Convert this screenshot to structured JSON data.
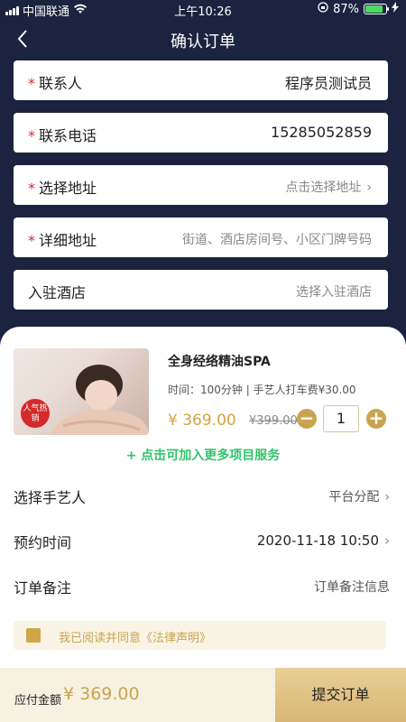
{
  "status_bar": {
    "carrier": "中国联通",
    "time": "上午10:26",
    "battery": "87%",
    "battery_level": 0.87
  },
  "nav": {
    "title": "确认订单"
  },
  "form": {
    "contact": {
      "label": "联系人",
      "value": "程序员测试员"
    },
    "phone": {
      "label": "联系电话",
      "value": "15285052859"
    },
    "address": {
      "label": "选择地址",
      "hint": "点击选择地址"
    },
    "detail": {
      "label": "详细地址",
      "placeholder": "街道、酒店房间号、小区门牌号码"
    },
    "hotel": {
      "label": "入驻酒店",
      "hint": "选择入驻酒店"
    }
  },
  "required_mark": "*",
  "product": {
    "badge": "人气热销",
    "name": "全身经络精油SPA",
    "meta": "时间：100分钟 | 手艺人打车费¥30.00",
    "price": "¥ 369.00",
    "old_price": "¥399.00",
    "quantity": "1",
    "minus": "−",
    "plus": "+"
  },
  "add_more": "+ 点击可加入更多项目服务",
  "rows": {
    "artisan": {
      "label": "选择手艺人",
      "value": "平台分配"
    },
    "time": {
      "label": "预约时间",
      "value": "2020-11-18 10:50"
    },
    "note": {
      "label": "订单备注",
      "value": "订单备注信息"
    }
  },
  "agreement": "我已阅读并同意《法律声明》",
  "footer": {
    "total_label": "应付金额",
    "total_value": "¥ 369.00",
    "submit": "提交订单"
  },
  "colors": {
    "header_bg": "#1c2340",
    "accent": "#c9a450",
    "green": "#31c46c",
    "required": "#e0242a"
  }
}
